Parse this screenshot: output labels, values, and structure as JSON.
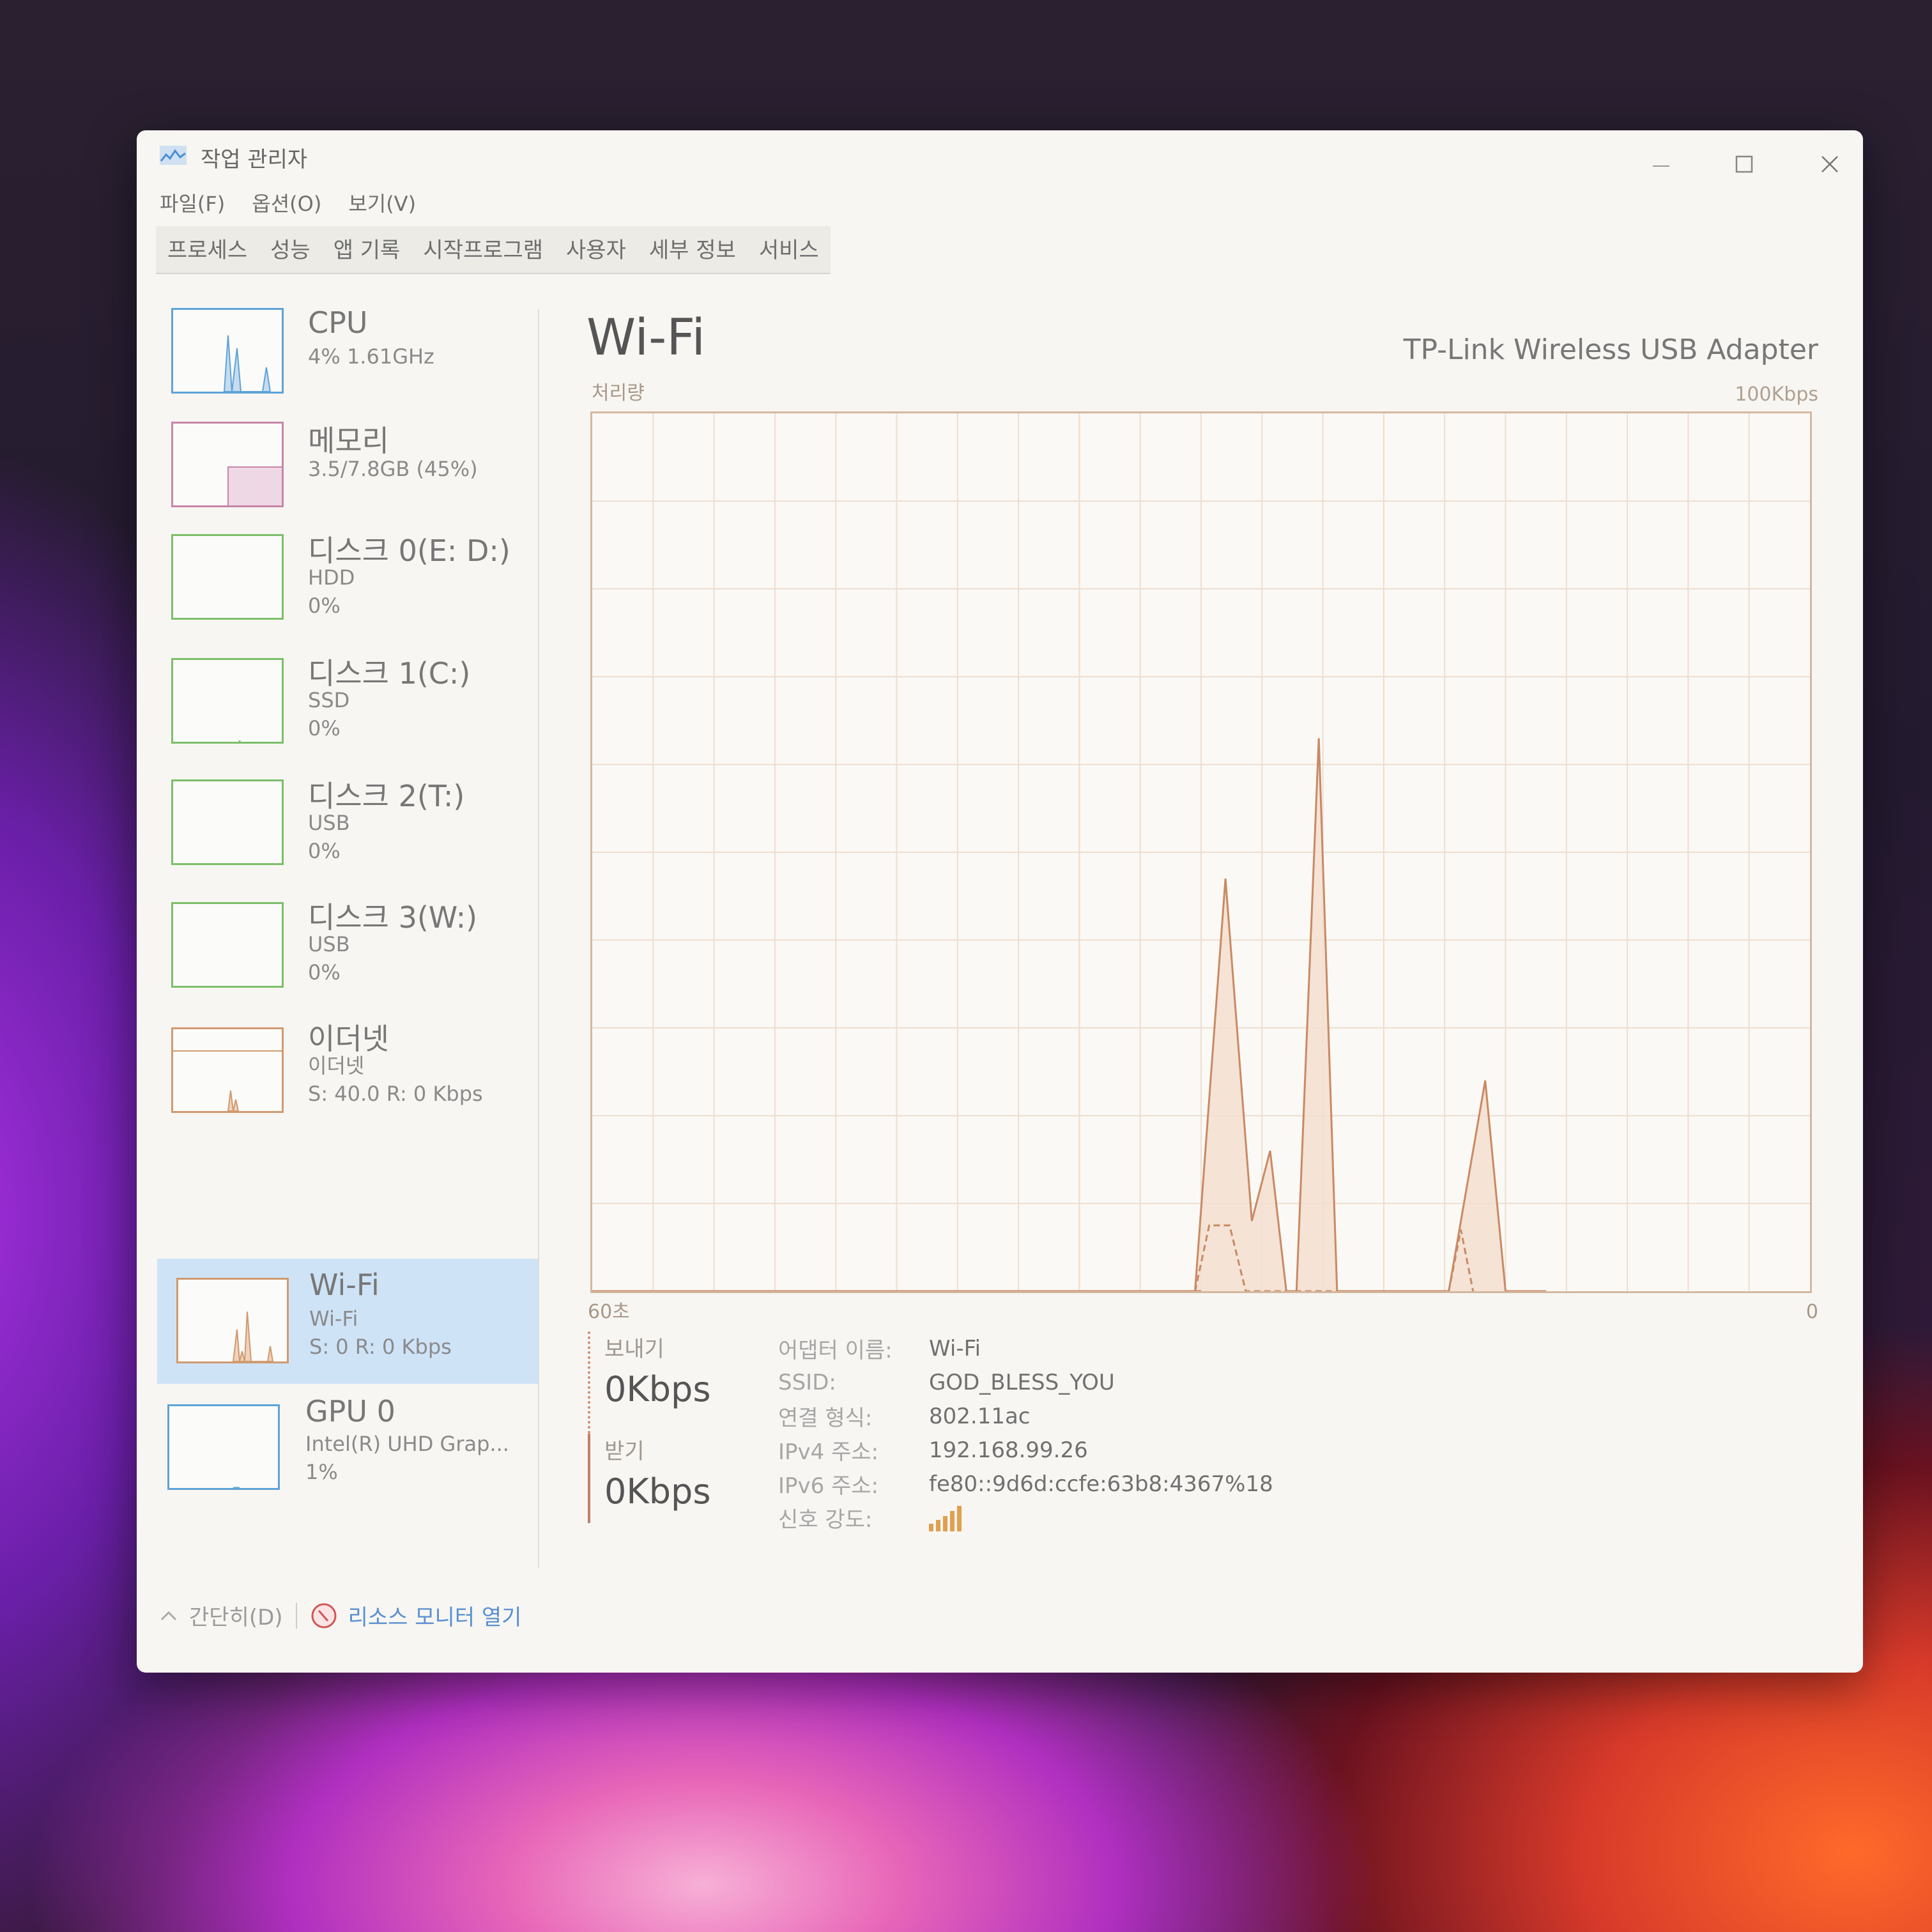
{
  "window": {
    "title": "작업 관리자"
  },
  "menu": [
    "파일(F)",
    "옵션(O)",
    "보기(V)"
  ],
  "tabs": [
    "프로세스",
    "성능",
    "앱 기록",
    "시작프로그램",
    "사용자",
    "세부 정보",
    "서비스"
  ],
  "sidebar": [
    {
      "name": "CPU",
      "sub1": "4% 1.61GHz",
      "sub2": "",
      "sub3": ""
    },
    {
      "name": "메모리",
      "sub1": "3.5/7.8GB (45%)",
      "sub2": "",
      "sub3": ""
    },
    {
      "name": "디스크 0(E: D:)",
      "sub1": "HDD",
      "sub2": "0%",
      "sub3": ""
    },
    {
      "name": "디스크 1(C:)",
      "sub1": "SSD",
      "sub2": "0%",
      "sub3": ""
    },
    {
      "name": "디스크 2(T:)",
      "sub1": "USB",
      "sub2": "0%",
      "sub3": ""
    },
    {
      "name": "디스크 3(W:)",
      "sub1": "USB",
      "sub2": "0%",
      "sub3": ""
    },
    {
      "name": "이더넷",
      "sub1": "이더넷",
      "sub2": "S: 40.0 R: 0 Kbps",
      "sub3": ""
    },
    {
      "name": "Wi-Fi",
      "sub1": "Wi-Fi",
      "sub2": "S: 0 R: 0 Kbps",
      "sub3": ""
    },
    {
      "name": "GPU 0",
      "sub1": "Intel(R) UHD Grap...",
      "sub2": "1%",
      "sub3": ""
    }
  ],
  "panel": {
    "title": "Wi-Fi",
    "adapter": "TP-Link Wireless USB Adapter",
    "chart_label": "처리량",
    "chart_max": "100Kbps",
    "chart_x_left": "60초",
    "chart_y_min": "0"
  },
  "chart_data": {
    "type": "area",
    "ylim": [
      0,
      100
    ],
    "xlim": [
      60,
      0
    ],
    "series": [
      {
        "values": [
          [
            60,
            0
          ],
          [
            50,
            0
          ],
          [
            40,
            0
          ],
          [
            30,
            0
          ],
          [
            30.3,
            0
          ],
          [
            28.8,
            47
          ],
          [
            27.5,
            8
          ],
          [
            26.6,
            16
          ],
          [
            25.8,
            0
          ],
          [
            25.3,
            0
          ],
          [
            24.2,
            63
          ],
          [
            23.3,
            0
          ],
          [
            17.8,
            0
          ],
          [
            16,
            24
          ],
          [
            15,
            0
          ],
          [
            13,
            0
          ]
        ]
      },
      {
        "values": [
          [
            30.3,
            0
          ],
          [
            29.6,
            7.5
          ],
          [
            28.6,
            7.5
          ],
          [
            27.8,
            0
          ],
          [
            17.8,
            0
          ],
          [
            17.2,
            7
          ],
          [
            16.6,
            0
          ]
        ]
      }
    ]
  },
  "stats": {
    "send_label": "보내기",
    "send_value": "0Kbps",
    "recv_label": "받기",
    "recv_value": "0Kbps"
  },
  "info": [
    {
      "key": "어댑터 이름:",
      "val": "Wi-Fi"
    },
    {
      "key": "SSID:",
      "val": "GOD_BLESS_YOU"
    },
    {
      "key": "연결 형식:",
      "val": "802.11ac"
    },
    {
      "key": "IPv4 주소:",
      "val": "192.168.99.26"
    },
    {
      "key": "IPv6 주소:",
      "val": "fe80::9d6d:ccfe:63b8:4367%18"
    },
    {
      "key": "신호 강도:",
      "val": ""
    }
  ],
  "footer": {
    "collapse_label": "간단히(D)",
    "monitor_label": "리소스 모니터 열기"
  },
  "colors": {
    "accent": "#5a8fd0",
    "wifi_line": "#c98a64",
    "wifi_fill": "#f3dfcf",
    "selected": "#cfe3f7"
  }
}
